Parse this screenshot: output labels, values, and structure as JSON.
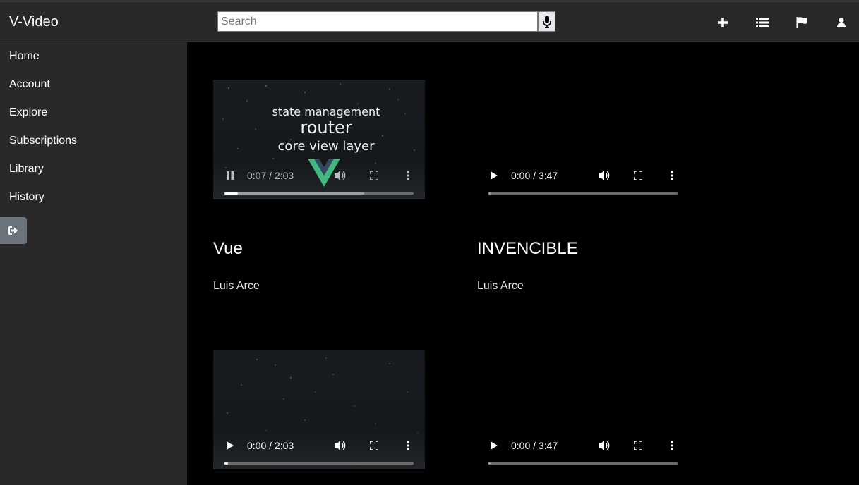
{
  "app": {
    "brand": "V-Video"
  },
  "search": {
    "placeholder": "Search",
    "value": ""
  },
  "header_icons": [
    "plus-icon",
    "list-icon",
    "flag-icon",
    "user-icon"
  ],
  "sidebar": {
    "items": [
      {
        "label": "Home"
      },
      {
        "label": "Account"
      },
      {
        "label": "Explore"
      },
      {
        "label": "Subscriptions"
      },
      {
        "label": "Library"
      },
      {
        "label": "History"
      }
    ],
    "logout_icon": "sign-out-icon"
  },
  "videos": [
    {
      "title": "Vue",
      "author": "Luis Arce",
      "time": "0:07 / 2:03",
      "state": "playing",
      "progress": 0.07,
      "buffered": 0.74,
      "slide_lines": [
        "state management",
        "router",
        "core view layer"
      ]
    },
    {
      "title": "INVENCIBLE",
      "author": "Luis Arce",
      "time": "0:00 / 3:47",
      "state": "paused",
      "progress": 0,
      "buffered": 0.01
    },
    {
      "time": "0:00 / 2:03",
      "state": "paused",
      "progress": 0.02,
      "buffered": 0.02
    },
    {
      "time": "0:00 / 3:47",
      "state": "paused",
      "progress": 0,
      "buffered": 0.01
    }
  ],
  "colors": {
    "topbar": "#2a2828",
    "sidebar": "#2a2828",
    "main": "#000000",
    "logout_button": "#6c757d",
    "vue_green": "#42b883"
  }
}
